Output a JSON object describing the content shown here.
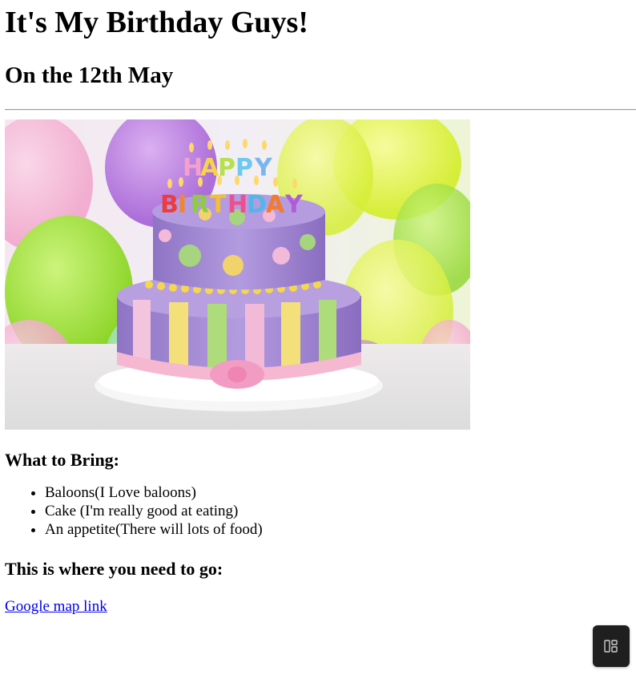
{
  "header": {
    "title": "It's My Birthday Guys!",
    "date": "On the 12th May"
  },
  "image": {
    "subject": "birthday cake with balloons",
    "cake_topper_text": "HAPPY BIRTHDAY"
  },
  "bring_section": {
    "heading": "What to Bring:",
    "items": [
      "Baloons(I Love baloons)",
      "Cake (I'm really good at eating)",
      "An appetite(There will lots of food)"
    ]
  },
  "location_section": {
    "heading": "This is where you need to go:",
    "link_text": "Google map link"
  },
  "floating_button": {
    "icon": "layout-panel-icon"
  },
  "colors": {
    "link": "#0000ee",
    "fab_background": "#1f1f1f"
  }
}
